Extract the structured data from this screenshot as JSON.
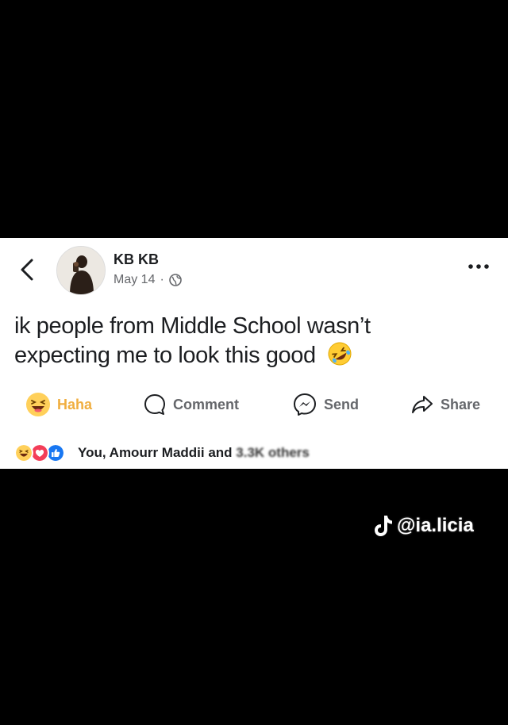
{
  "profile": {
    "name": "KB KB",
    "date": "May 14",
    "separator": "·",
    "privacy_icon": "globe-icon",
    "avatar_icon": "profile-photo"
  },
  "header": {
    "back_icon": "chevron-left-icon",
    "more_icon": "more-horizontal-icon"
  },
  "post": {
    "line1": "ik people from Middle School wasn’t",
    "line2": "expecting me to look this good",
    "emoji": "rolling-on-floor-laughing-emoji"
  },
  "actions": [
    {
      "label": "Haha",
      "icon": "haha-icon"
    },
    {
      "label": "Comment",
      "icon": "comment-icon"
    },
    {
      "label": "Send",
      "icon": "messenger-icon"
    },
    {
      "label": "Share",
      "icon": "share-icon"
    }
  ],
  "reactions": {
    "text_main": "You, Amourr Maddii and ",
    "text_obscured": "3.3K others",
    "icons": [
      "haha-icon",
      "love-icon",
      "like-icon"
    ]
  },
  "watermark": {
    "handle": "@ia.licia",
    "icon": "tiktok-icon"
  },
  "colors": {
    "haha": "#f0ae3f",
    "love": "#f33e58",
    "like": "#1877f2",
    "text": "#1c1e21",
    "secondary": "#65676b"
  }
}
